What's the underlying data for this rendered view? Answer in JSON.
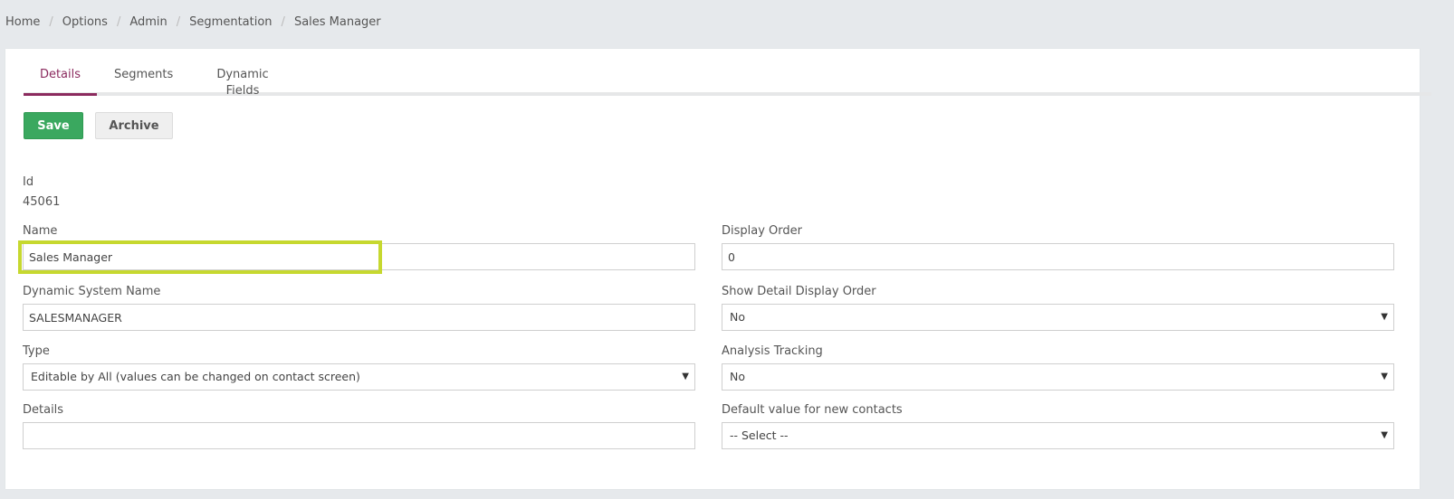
{
  "breadcrumb": {
    "items": [
      "Home",
      "Options",
      "Admin",
      "Segmentation"
    ],
    "current": "Sales Manager",
    "separator": "/"
  },
  "tabs": [
    {
      "label": "Details",
      "active": true
    },
    {
      "label": "Segments",
      "active": false
    },
    {
      "label": "Dynamic Fields",
      "active": false
    }
  ],
  "toolbar": {
    "save_label": "Save",
    "archive_label": "Archive"
  },
  "form": {
    "id_label": "Id",
    "id_value": "45061",
    "name_label": "Name",
    "name_value": "Sales Manager",
    "dynamic_system_name_label": "Dynamic System Name",
    "dynamic_system_name_value": "SALESMANAGER",
    "type_label": "Type",
    "type_value": "Editable by All (values can be changed on contact screen)",
    "details_label": "Details",
    "details_value": "",
    "display_order_label": "Display Order",
    "display_order_value": "0",
    "show_detail_display_order_label": "Show Detail Display Order",
    "show_detail_display_order_value": "No",
    "analysis_tracking_label": "Analysis Tracking",
    "analysis_tracking_value": "No",
    "default_value_label": "Default value for new contacts",
    "default_value_value": "-- Select --"
  },
  "colors": {
    "accent": "#8b2a5e",
    "save_button": "#3aa85f",
    "highlight": "#c6d82f",
    "background": "#e6e9ec"
  }
}
